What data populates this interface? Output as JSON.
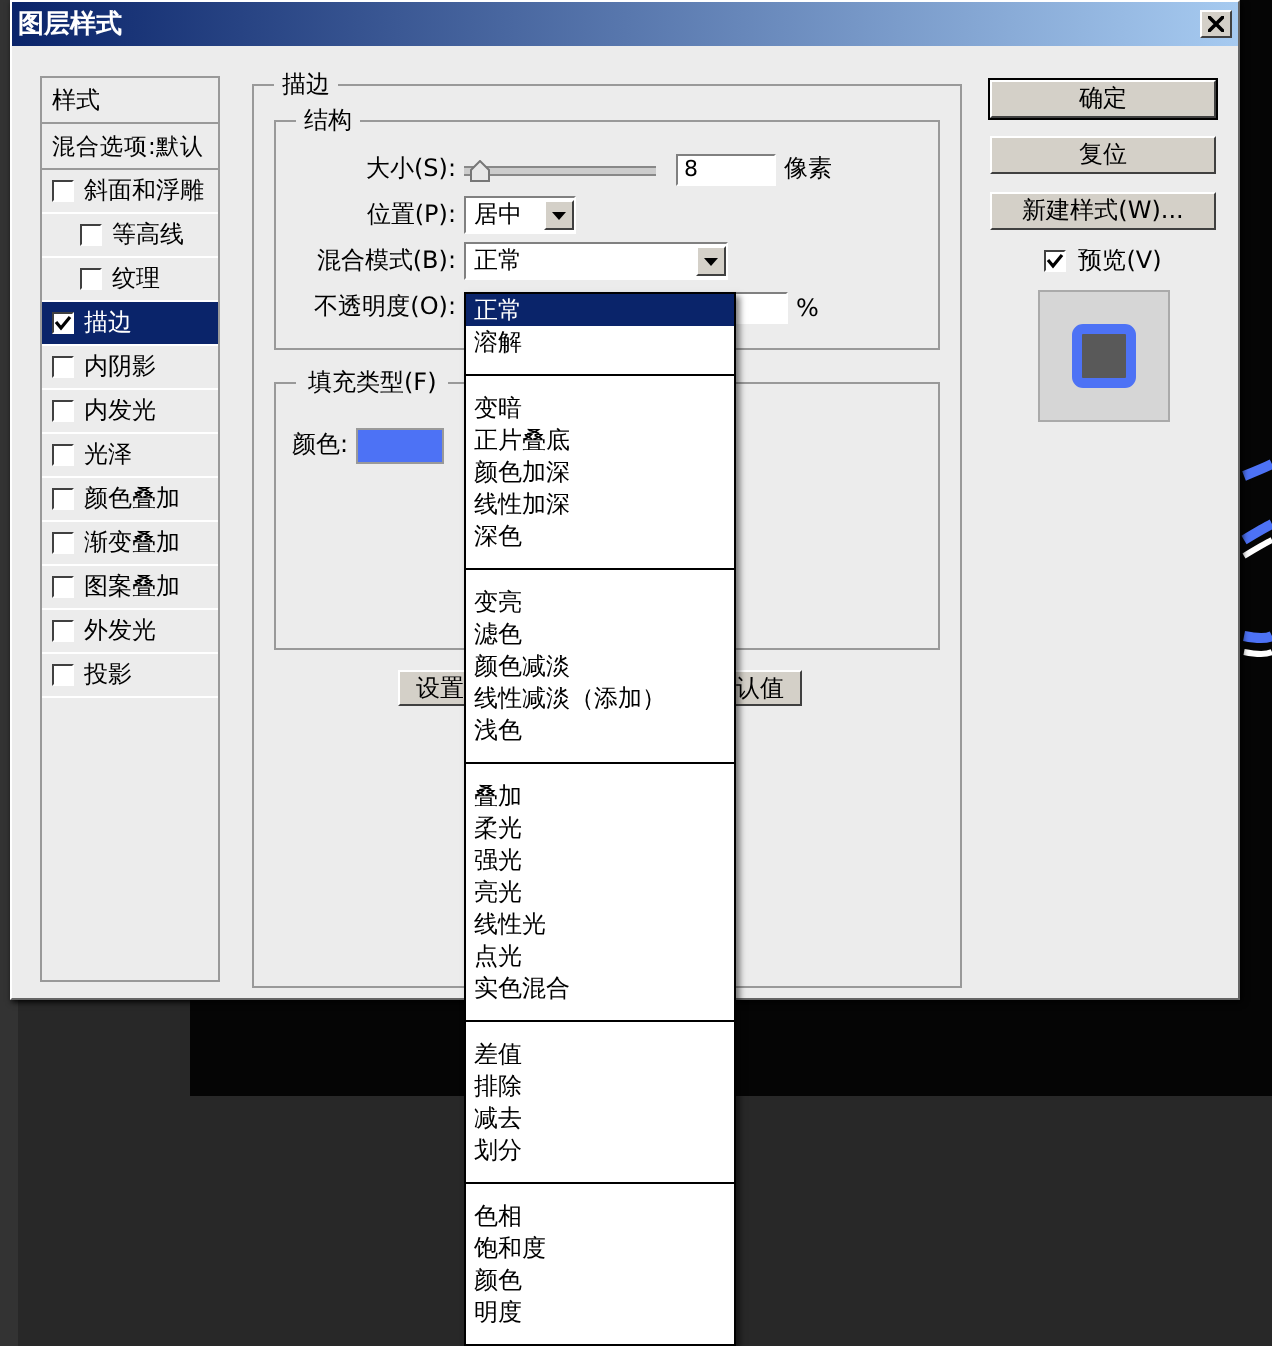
{
  "window": {
    "title": "图层样式"
  },
  "styles_list": {
    "header": "样式",
    "blend_options": "混合选项:默认",
    "items": [
      {
        "label": "斜面和浮雕",
        "checked": false,
        "selected": false,
        "children": [
          {
            "label": "等高线",
            "checked": false,
            "selected": false
          },
          {
            "label": "纹理",
            "checked": false,
            "selected": false
          }
        ]
      },
      {
        "label": "描边",
        "checked": true,
        "selected": true
      },
      {
        "label": "内阴影",
        "checked": false,
        "selected": false
      },
      {
        "label": "内发光",
        "checked": false,
        "selected": false
      },
      {
        "label": "光泽",
        "checked": false,
        "selected": false
      },
      {
        "label": "颜色叠加",
        "checked": false,
        "selected": false
      },
      {
        "label": "渐变叠加",
        "checked": false,
        "selected": false
      },
      {
        "label": "图案叠加",
        "checked": false,
        "selected": false
      },
      {
        "label": "外发光",
        "checked": false,
        "selected": false
      },
      {
        "label": "投影",
        "checked": false,
        "selected": false
      }
    ]
  },
  "stroke_panel": {
    "title": "描边",
    "structure": {
      "title": "结构",
      "size": {
        "label": "大小(S):",
        "level": 0.03,
        "value": "8",
        "unit": "像素"
      },
      "position": {
        "label": "位置(P):",
        "value": "居中"
      },
      "blend_mode": {
        "label": "混合模式(B):",
        "value": "正常"
      },
      "opacity": {
        "label": "不透明度(O):",
        "unit": "%"
      }
    },
    "fill": {
      "title": "填充类型(F)",
      "color_label": "颜色:",
      "color": "#4d72f5"
    },
    "buttons": [
      "设置",
      "认值"
    ]
  },
  "buttons": [
    {
      "label": "确定",
      "default": true
    },
    {
      "label": "复位",
      "default": false
    },
    {
      "label": "新建样式(W)...",
      "default": false
    }
  ],
  "preview": {
    "label": "预览(V)",
    "checked": true
  },
  "blend_menu": {
    "groups": [
      {
        "items": [
          {
            "label": "正常",
            "selected": true
          },
          {
            "label": "溶解",
            "selected": false
          }
        ]
      },
      {
        "items": [
          {
            "label": "变暗",
            "selected": false
          },
          {
            "label": "正片叠底",
            "selected": false
          },
          {
            "label": "颜色加深",
            "selected": false
          },
          {
            "label": "线性加深",
            "selected": false
          },
          {
            "label": "深色",
            "selected": false
          }
        ]
      },
      {
        "items": [
          {
            "label": "变亮",
            "selected": false
          },
          {
            "label": "滤色",
            "selected": false
          },
          {
            "label": "颜色减淡",
            "selected": false
          },
          {
            "label": "线性减淡（添加）",
            "selected": false
          },
          {
            "label": "浅色",
            "selected": false
          }
        ]
      },
      {
        "items": [
          {
            "label": "叠加",
            "selected": false
          },
          {
            "label": "柔光",
            "selected": false
          },
          {
            "label": "强光",
            "selected": false
          },
          {
            "label": "亮光",
            "selected": false
          },
          {
            "label": "线性光",
            "selected": false
          },
          {
            "label": "点光",
            "selected": false
          },
          {
            "label": "实色混合",
            "selected": false
          }
        ]
      },
      {
        "items": [
          {
            "label": "差值",
            "selected": false
          },
          {
            "label": "排除",
            "selected": false
          },
          {
            "label": "减去",
            "selected": false
          },
          {
            "label": "划分",
            "selected": false
          }
        ]
      },
      {
        "items": [
          {
            "label": "色相",
            "selected": false
          },
          {
            "label": "饱和度",
            "selected": false
          },
          {
            "label": "颜色",
            "selected": false
          },
          {
            "label": "明度",
            "selected": false
          }
        ]
      }
    ]
  }
}
